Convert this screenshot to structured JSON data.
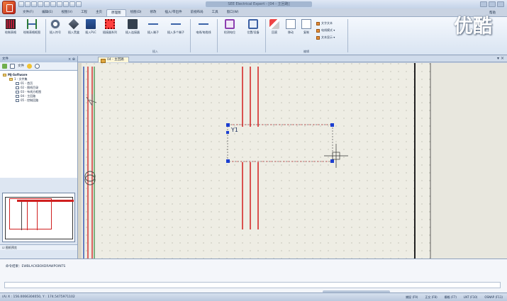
{
  "window": {
    "title": "SEE Electrical Expert - [04 - 主回路]",
    "watermark": "优酷"
  },
  "ribbon": {
    "tabs": [
      {
        "label": "文件(F)"
      },
      {
        "label": "编辑(E)"
      },
      {
        "label": "视图(V)"
      },
      {
        "label": "工程"
      },
      {
        "label": "主页"
      },
      {
        "label": "原理图",
        "active": true
      },
      {
        "label": "绘图(D)"
      },
      {
        "label": "修改"
      },
      {
        "label": "插入/带出件"
      },
      {
        "label": "前视布局"
      },
      {
        "label": "工具"
      },
      {
        "label": "窗口(W)"
      }
    ],
    "help": "帮助",
    "buttons": [
      {
        "label": "绘制表格",
        "icon": "table-icon"
      },
      {
        "label": "绘制表格框图",
        "icon": "frame-icon"
      },
      {
        "label": "插入符号",
        "icon": "symbol-icon"
      },
      {
        "label": "插入黑盒",
        "icon": "blackbox-icon"
      },
      {
        "label": "插入PLC",
        "icon": "plc-icon"
      },
      {
        "label": "插接器系列",
        "icon": "connector-series-icon"
      },
      {
        "label": "插入连接器",
        "icon": "connector-icon"
      },
      {
        "label": "插入端子",
        "icon": "terminal-icon"
      },
      {
        "label": "插入多个端子",
        "icon": "multi-terminal-icon"
      },
      {
        "label": "电线/电缆线",
        "icon": "wire-icon"
      },
      {
        "label": "检测电位",
        "icon": "check-potential-icon"
      },
      {
        "label": "位置/设备",
        "icon": "location-icon"
      },
      {
        "label": "回滚",
        "icon": "undo-icon"
      },
      {
        "label": "移动",
        "icon": "move-icon"
      },
      {
        "label": "复制",
        "icon": "copy-icon"
      }
    ],
    "small_buttons": [
      {
        "label": "文字文本"
      },
      {
        "label": "电线模式"
      },
      {
        "label": "文本显示"
      }
    ],
    "group_insert": "插入",
    "group_edit": "编辑"
  },
  "left_pane": {
    "title": "文件",
    "toolbar_label": "文件",
    "tree": [
      {
        "label": "MJ-Software",
        "level": 0,
        "type": "root"
      },
      {
        "label": "1 - 文件集",
        "level": 1,
        "type": "folder"
      },
      {
        "label": "01 - 首页",
        "level": 2,
        "type": "page"
      },
      {
        "label": "02 - 图纸目录",
        "level": 2,
        "type": "page"
      },
      {
        "label": "03 - 布线方框图",
        "level": 2,
        "type": "page"
      },
      {
        "label": "04 - 主回路",
        "level": 2,
        "type": "page"
      },
      {
        "label": "05 - 控制回路",
        "level": 2,
        "type": "page"
      }
    ],
    "preview_checkbox": "图纸预览"
  },
  "document_tab": "04 - 主回路",
  "canvas": {
    "component_label": "Y1"
  },
  "command": {
    "output": "命令结果：EWBLACKBOXDRAWPOINTS",
    "input_value": ""
  },
  "statusbar": {
    "coords": "(A) X : 156.0066304050, Y : 174.5475971102",
    "toggles": [
      "捕捉 (F9)",
      "正交 (F8)",
      "栅格 (F7)",
      "LNT (F10)",
      "OSNAP (F11)"
    ]
  }
}
